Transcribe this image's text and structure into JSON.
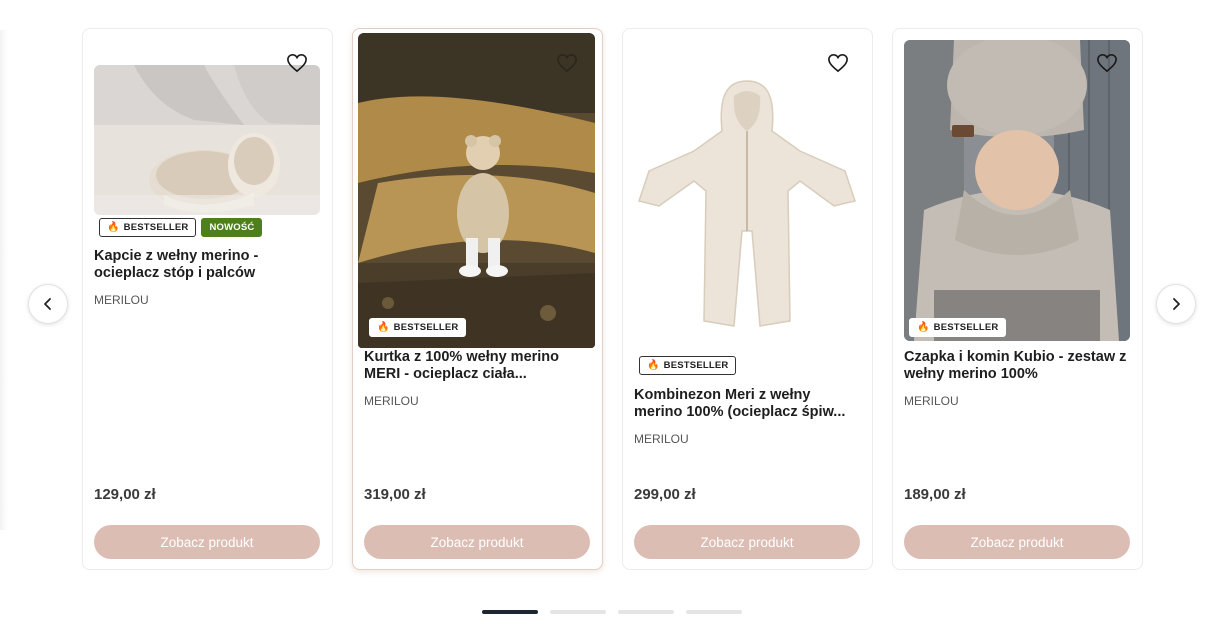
{
  "carousel": {
    "prev_icon": "chevron-left-icon",
    "next_icon": "chevron-right-icon",
    "pages_total": 4,
    "active_page": 1
  },
  "colors": {
    "cta": "#dcbdb3",
    "new_badge": "#4d7f1a",
    "pager_active": "#1d2533"
  },
  "products": [
    {
      "title": "Kapcie z wełny merino - ocieplacz stóp i palców",
      "brand": "MERILOU",
      "price": "129,00 zł",
      "cta": "Zobacz produkt",
      "badges": [
        {
          "icon": "fire-icon",
          "label": "BESTSELLER"
        },
        {
          "label": "NOWOŚĆ"
        }
      ]
    },
    {
      "title": "Kurtka z 100% wełny merino MERI - ocieplacz ciała...",
      "brand": "MERILOU",
      "price": "319,00 zł",
      "cta": "Zobacz produkt",
      "badges": [
        {
          "icon": "fire-icon",
          "label": "BESTSELLER"
        }
      ]
    },
    {
      "title": "Kombinezon Meri z wełny merino 100% (ocieplacz śpiw...",
      "brand": "MERILOU",
      "price": "299,00 zł",
      "cta": "Zobacz produkt",
      "badges": [
        {
          "icon": "fire-icon",
          "label": "BESTSELLER"
        }
      ]
    },
    {
      "title": "Czapka i komin Kubio - zestaw z wełny merino 100%",
      "brand": "MERILOU",
      "price": "189,00 zł",
      "cta": "Zobacz produkt",
      "badges": [
        {
          "icon": "fire-icon",
          "label": "BESTSELLER"
        }
      ]
    }
  ]
}
